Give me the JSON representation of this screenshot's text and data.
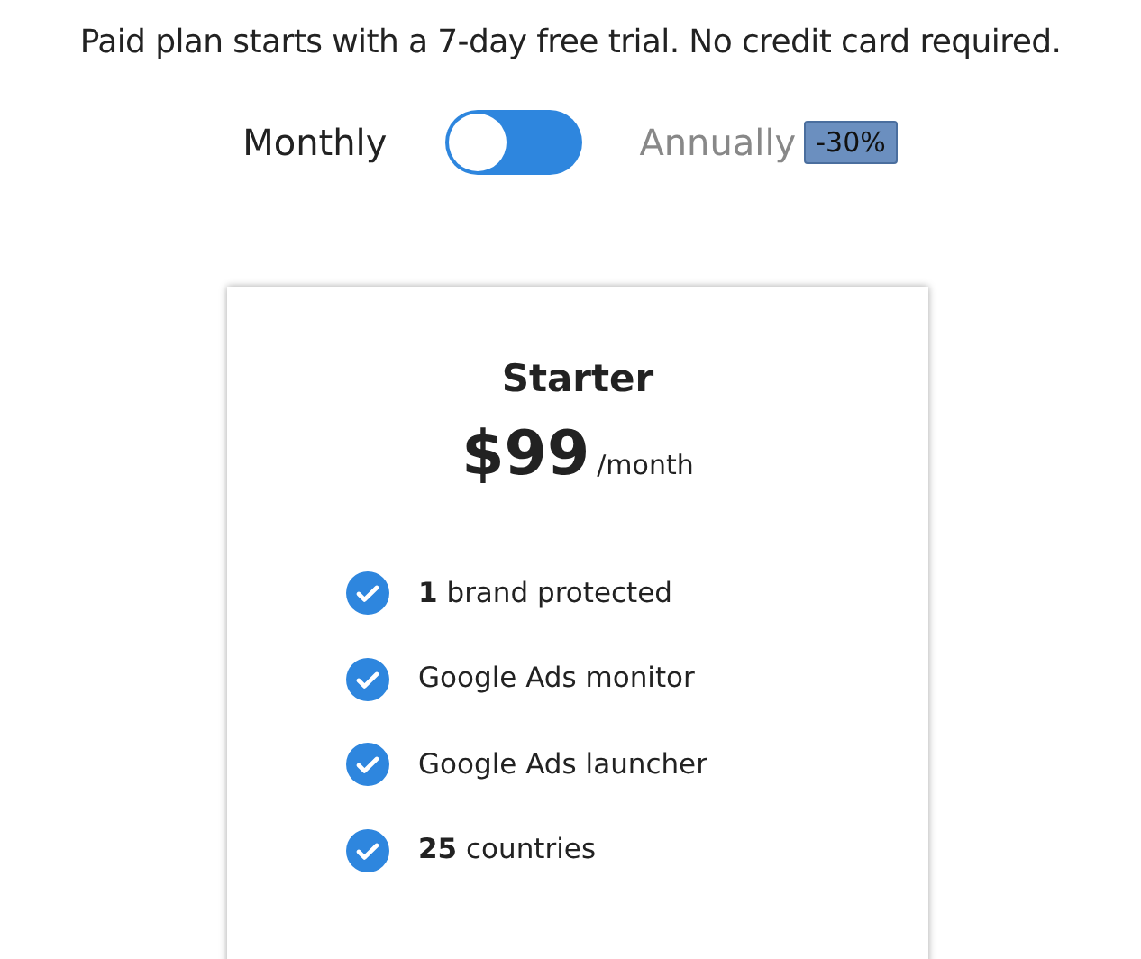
{
  "intro": "Paid plan starts with a 7-day free trial. No credit card required.",
  "billing_toggle": {
    "left_label": "Monthly",
    "right_label": "Annually",
    "on": false,
    "discount_badge": "-30%"
  },
  "plan": {
    "name": "Starter",
    "price": "$99",
    "period": "/month",
    "features": [
      {
        "text": "**1** brand protected",
        "checked": true
      },
      {
        "text": "Google Ads monitor",
        "checked": true
      },
      {
        "text": "Google Ads launcher",
        "checked": true
      },
      {
        "text": "**25** countries",
        "checked": true
      }
    ]
  }
}
